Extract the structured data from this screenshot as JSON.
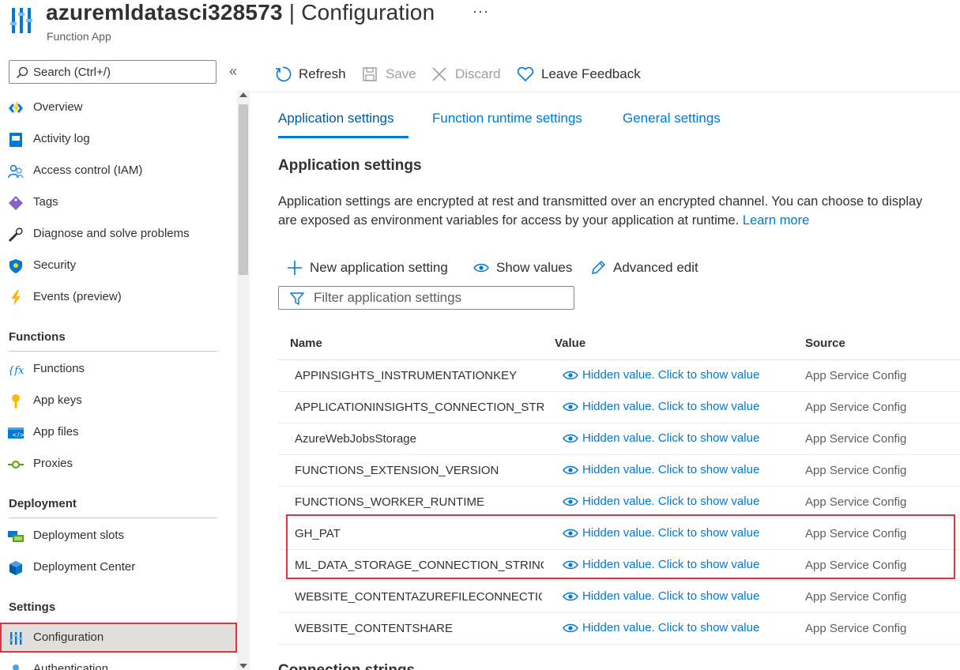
{
  "header": {
    "resource_name": "azuremldatasci328573",
    "separator": " | ",
    "page": "Configuration",
    "more": "···",
    "subtitle": "Function App"
  },
  "sidebar": {
    "search_placeholder": "Search (Ctrl+/)",
    "collapse": "«",
    "items_top": [
      {
        "label": "Overview",
        "icon": "function-app-lightning-icon"
      },
      {
        "label": "Activity log",
        "icon": "activity-log-icon"
      },
      {
        "label": "Access control (IAM)",
        "icon": "people-icon"
      },
      {
        "label": "Tags",
        "icon": "tag-icon"
      },
      {
        "label": "Diagnose and solve problems",
        "icon": "wrench-icon"
      },
      {
        "label": "Security",
        "icon": "shield-icon"
      },
      {
        "label": "Events (preview)",
        "icon": "lightning-icon"
      }
    ],
    "functions_header": "Functions",
    "functions_items": [
      {
        "label": "Functions",
        "icon": "fx-icon"
      },
      {
        "label": "App keys",
        "icon": "key-icon"
      },
      {
        "label": "App files",
        "icon": "code-file-icon"
      },
      {
        "label": "Proxies",
        "icon": "proxy-icon"
      }
    ],
    "deployment_header": "Deployment",
    "deployment_items": [
      {
        "label": "Deployment slots",
        "icon": "slots-icon"
      },
      {
        "label": "Deployment Center",
        "icon": "cube-icon"
      }
    ],
    "settings_header": "Settings",
    "settings_items": [
      {
        "label": "Configuration",
        "icon": "config-sliders-icon",
        "active": true
      },
      {
        "label": "Authentication",
        "icon": "person-icon"
      }
    ]
  },
  "toolbar": {
    "refresh": "Refresh",
    "save": "Save",
    "discard": "Discard",
    "feedback": "Leave Feedback"
  },
  "tabs": [
    "Application settings",
    "Function runtime settings",
    "General settings"
  ],
  "main": {
    "heading": "Application settings",
    "description_line1": "Application settings are encrypted at rest and transmitted over an encrypted channel. You can choose to display",
    "description_line2": "are exposed as environment variables for access by your application at runtime.",
    "learn_more": "Learn more",
    "new_setting": "New application setting",
    "show_values": "Show values",
    "advanced_edit": "Advanced edit",
    "filter_placeholder": "Filter application settings",
    "next_section": "Connection strings"
  },
  "table": {
    "columns": [
      "Name",
      "Value",
      "Source"
    ],
    "rows": [
      {
        "name": "APPINSIGHTS_INSTRUMENTATIONKEY",
        "value": "Hidden value. Click to show value",
        "source": "App Service Config"
      },
      {
        "name": "APPLICATIONINSIGHTS_CONNECTION_STRING",
        "value": "Hidden value. Click to show value",
        "source": "App Service Config"
      },
      {
        "name": "AzureWebJobsStorage",
        "value": "Hidden value. Click to show value",
        "source": "App Service Config"
      },
      {
        "name": "FUNCTIONS_EXTENSION_VERSION",
        "value": "Hidden value. Click to show value",
        "source": "App Service Config"
      },
      {
        "name": "FUNCTIONS_WORKER_RUNTIME",
        "value": "Hidden value. Click to show value",
        "source": "App Service Config"
      },
      {
        "name": "GH_PAT",
        "value": "Hidden value. Click to show value",
        "source": "App Service Config"
      },
      {
        "name": "ML_DATA_STORAGE_CONNECTION_STRING",
        "value": "Hidden value. Click to show value",
        "source": "App Service Config"
      },
      {
        "name": "WEBSITE_CONTENTAZUREFILECONNECTIONSTRING",
        "value": "Hidden value. Click to show value",
        "source": "App Service Config"
      },
      {
        "name": "WEBSITE_CONTENTSHARE",
        "value": "Hidden value. Click to show value",
        "source": "App Service Config"
      }
    ]
  },
  "colors": {
    "accent": "#0078d4",
    "highlight": "#e0333b"
  }
}
